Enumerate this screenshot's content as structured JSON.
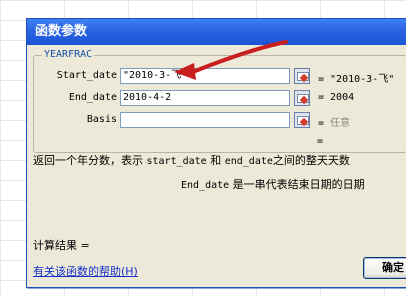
{
  "dialog": {
    "title": "函数参数",
    "function_name": "YEARFRAC",
    "args": [
      {
        "label": "Start_date",
        "value": "\"2010-3-飞\"",
        "result": "= \"2010-3-飞\"",
        "hint": ""
      },
      {
        "label": "End_date",
        "value": "2010-4-2",
        "result": "= 2004",
        "hint": ""
      },
      {
        "label": "Basis",
        "value": "",
        "result": "=",
        "hint": "任意"
      }
    ],
    "trailing_equals": "=",
    "description_prefix": "返回一个年分数，表示",
    "description_code1": "start_date",
    "description_mid": "和",
    "description_code2": "end_date",
    "description_suffix": "之间的整天天数",
    "param_name": "End_date",
    "param_description": "是一串代表结束日期的日期",
    "result_label": "计算结果 =",
    "help_link": "有关该函数的帮助(H)",
    "ok_label": "确定"
  },
  "colors": {
    "titlebar": "#2a64e3",
    "dialog_bg": "#ece9d8",
    "annotation_arrow": "#c81e1e",
    "link": "#1430c8"
  }
}
